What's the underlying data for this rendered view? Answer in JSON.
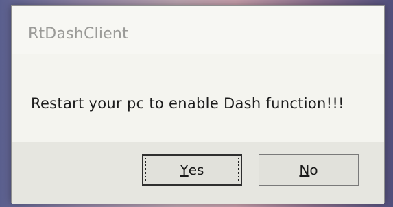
{
  "dialog": {
    "title": "RtDashClient",
    "message": "Restart your pc to enable Dash function!!!"
  },
  "buttons": {
    "yes": {
      "mnemonic": "Y",
      "rest": "es"
    },
    "no": {
      "mnemonic": "N",
      "rest": "o"
    }
  }
}
